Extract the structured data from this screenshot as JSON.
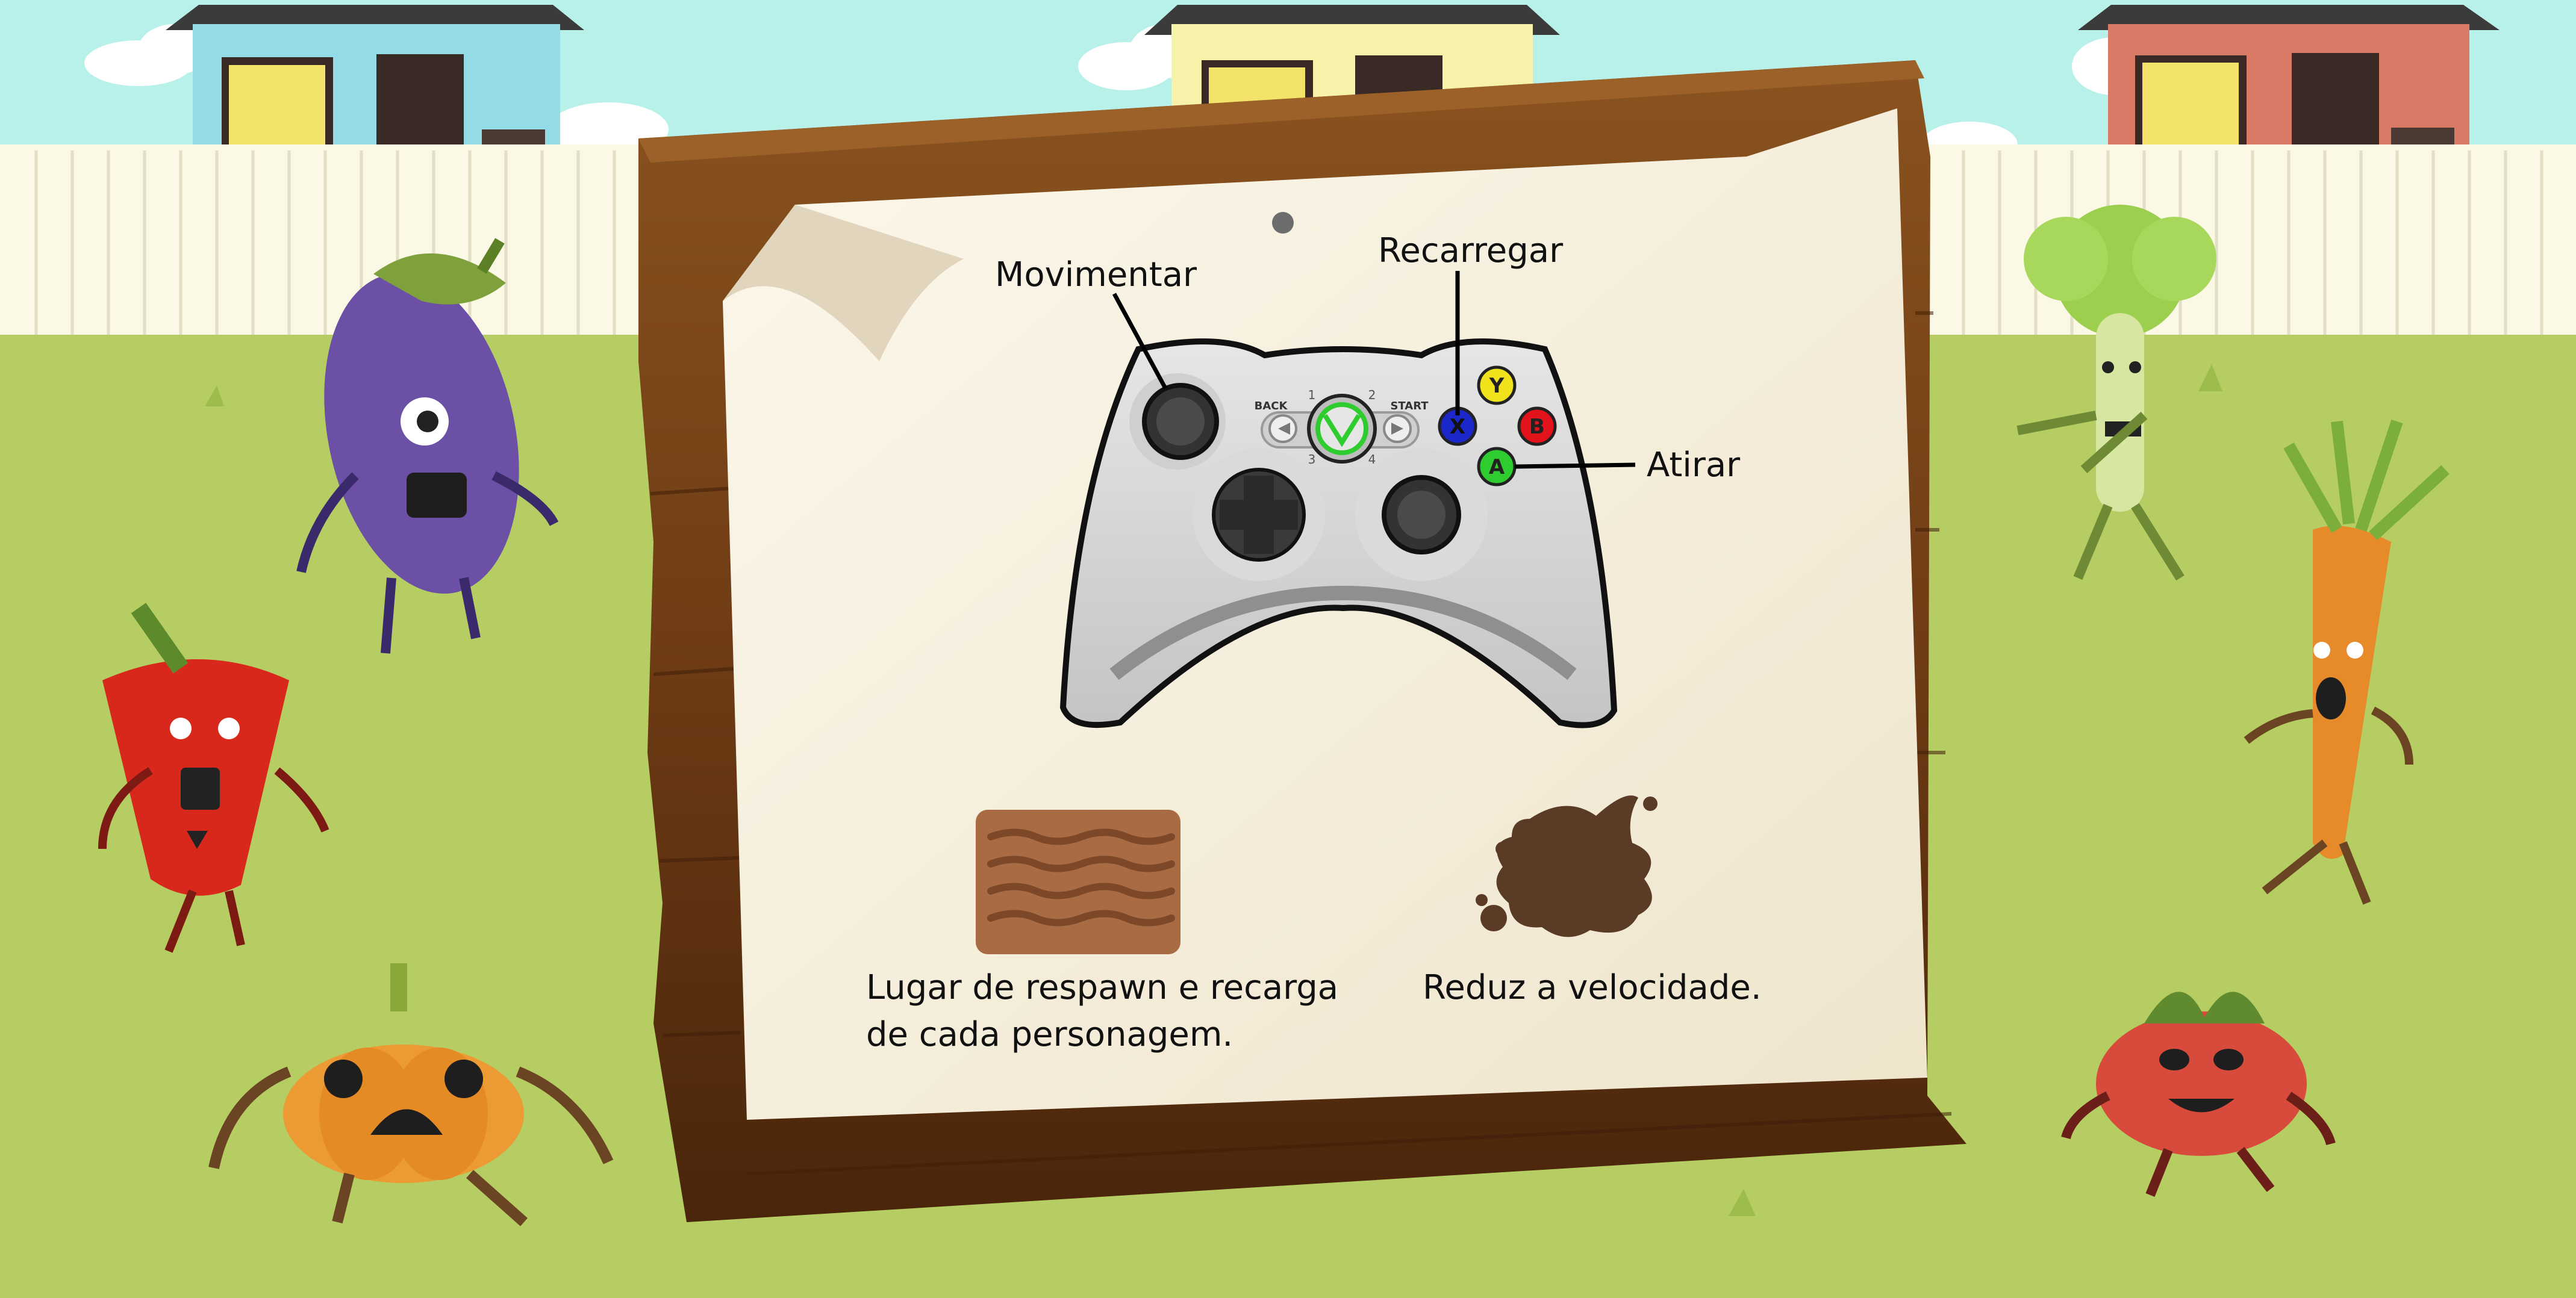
{
  "controls": {
    "move_label": "Movimentar",
    "reload_label": "Recarregar",
    "shoot_label": "Atirar"
  },
  "controller": {
    "button_y": "Y",
    "button_b": "B",
    "button_a": "A",
    "button_x": "X",
    "back_label": "BACK",
    "start_label": "START",
    "player_1": "1",
    "player_2": "2",
    "player_3": "3",
    "player_4": "4"
  },
  "legend": {
    "spawn_caption": "Lugar de respawn e recarga de cada personagem.",
    "mud_caption": "Reduz a velocidade."
  },
  "colors": {
    "sky": "#b8f1ea",
    "grass": "#b5cd62",
    "fence": "#fbf9e6",
    "board_wood": "#7a4518",
    "paper": "#f4eddc",
    "button_y": "#f1e21b",
    "button_b": "#e3131b",
    "button_a": "#2fcc2f",
    "button_x": "#1b27c8",
    "xbox_green": "#2fcc2f",
    "spawn_pad": "#a86b43",
    "mud": "#5a3b26"
  },
  "characters": {
    "icons": [
      "eggplant-character",
      "pepper-character",
      "pumpkin-character",
      "broccoli-character",
      "carrot-character",
      "tomato-character"
    ]
  }
}
